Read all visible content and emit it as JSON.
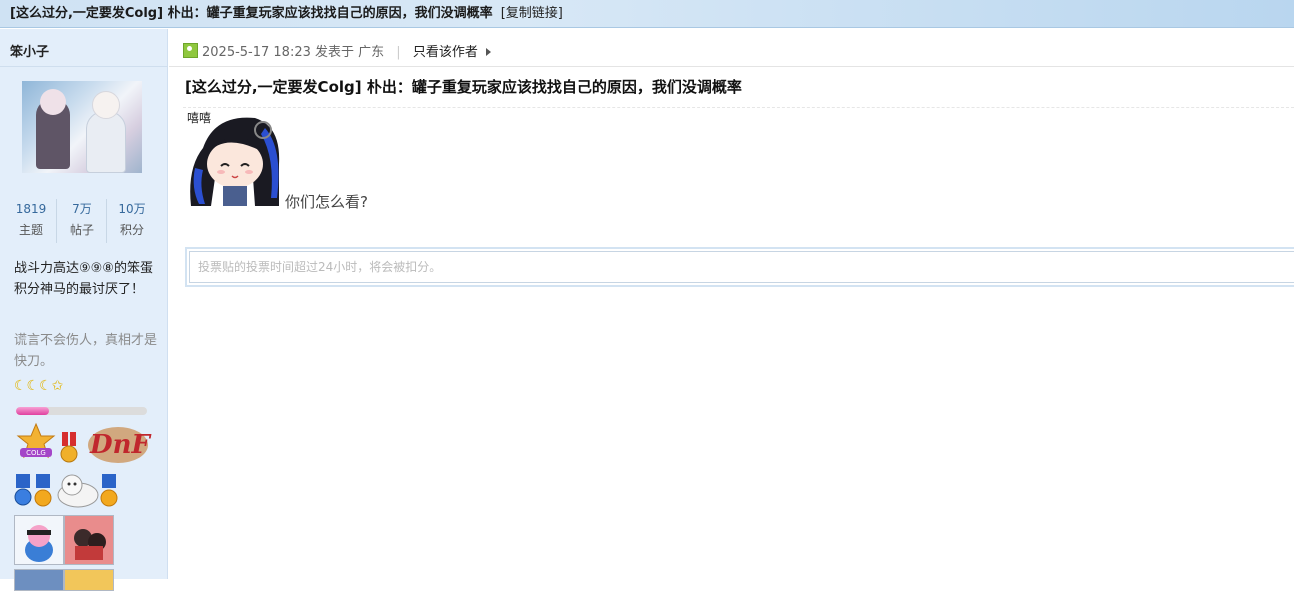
{
  "topbar": {
    "title": "[这么过分,一定要发Colg] 朴出：罐子重复玩家应该找找自己的原因，我们没调概率",
    "copy_link": "[复制链接]"
  },
  "user": {
    "name": "笨小子",
    "stats": [
      {
        "value": "1819",
        "label": "主题"
      },
      {
        "value": "7万",
        "label": "帖子"
      },
      {
        "value": "10万",
        "label": "积分"
      }
    ],
    "bio": "战斗力高达⑨⑨⑧的笨蛋积分神马的最讨厌了！",
    "motto": "谎言不会伤人，真相才是快刀。",
    "rank_icons": "☾☾☾✩",
    "level_progress": 0.25,
    "avatar_icon": "avatar-image"
  },
  "post": {
    "date": "2025-5-17 18:23",
    "posted_in": "发表于 广东",
    "only_author": "只看该作者",
    "title": "[这么过分,一定要发Colg] 朴出：罐子重复玩家应该找找自己的原因，我们没调概率",
    "sticker_text": "嘻嘻",
    "body": "你们怎么看?"
  },
  "vote": {
    "placeholder": "投票贴的投票时间超过24小时，将会被扣分。"
  },
  "colors": {
    "sidebar_bg": "#e3eefa",
    "topbar_bg": "#cfe2f3",
    "progress": "#e0409f"
  }
}
